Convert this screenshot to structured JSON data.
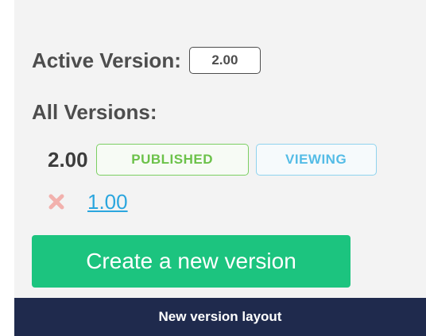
{
  "active_version": {
    "label": "Active Version:",
    "value": "2.00"
  },
  "all_versions": {
    "label": "All Versions:",
    "items": [
      {
        "version": "2.00",
        "tags": [
          "PUBLISHED",
          "VIEWING"
        ]
      },
      {
        "version": "1.00",
        "delete_icon": "x-icon"
      }
    ]
  },
  "create_button": {
    "label": "Create a new version"
  },
  "caption": "New version layout",
  "colors": {
    "panel_bg": "#f3f3f3",
    "published": "#6cc24a",
    "viewing": "#54bce6",
    "delete_icon": "#f2b1ad",
    "link": "#2ba6de",
    "primary_button": "#1cc47f",
    "footer_bg": "#1f2a4d"
  }
}
